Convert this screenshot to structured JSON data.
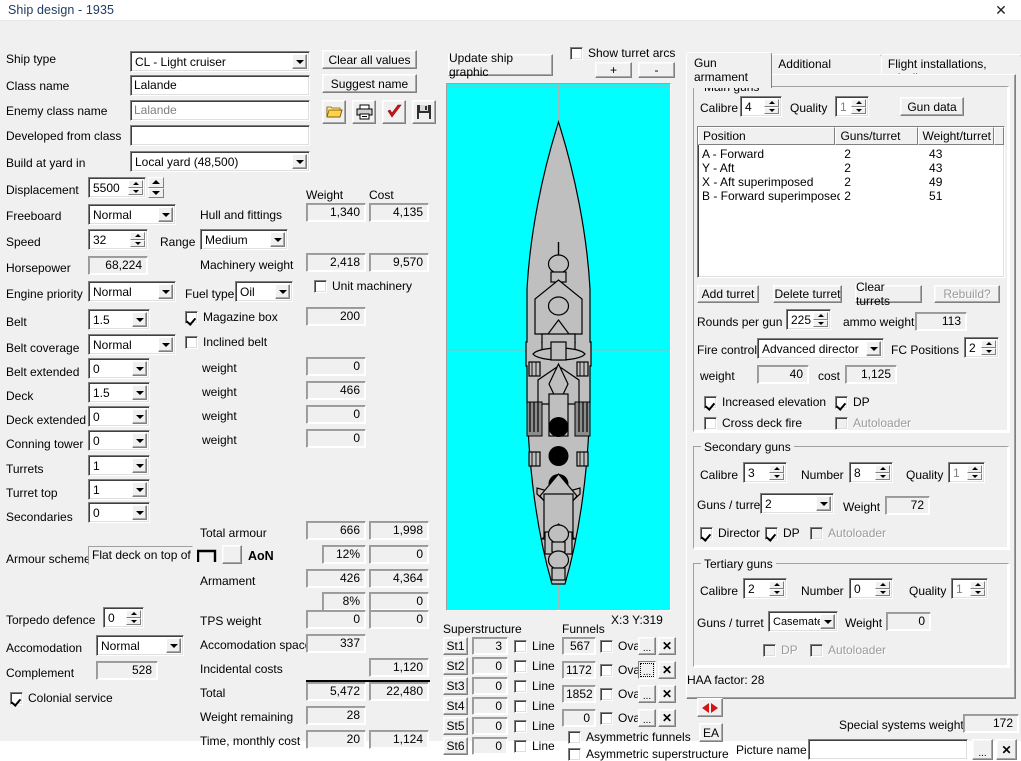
{
  "window": {
    "title": "Ship design - 1935",
    "close_icon": "close-icon"
  },
  "left": {
    "fields": [
      {
        "label": "Ship type",
        "value": "CL - Light cruiser",
        "type": "combo"
      },
      {
        "label": "Class name",
        "value": "Lalande",
        "type": "text"
      },
      {
        "label": "Enemy class name",
        "value": "Lalande",
        "type": "text-disabled"
      },
      {
        "label": "Developed from class",
        "value": "",
        "type": "text"
      },
      {
        "label": "Build at yard in",
        "value": "Local yard (48,500)",
        "type": "combo"
      }
    ],
    "displacement": {
      "label": "Displacement",
      "value": "5500"
    },
    "freeboard": {
      "label": "Freeboard",
      "value": "Normal"
    },
    "speed": {
      "label": "Speed",
      "value": "32"
    },
    "range": {
      "label": "Range",
      "value": "Medium"
    },
    "horsepower": {
      "label": "Horsepower",
      "value": "68,224"
    },
    "engine_priority": {
      "label": "Engine priority",
      "value": "Normal"
    },
    "fuel_type": {
      "label": "Fuel type",
      "value": "Oil"
    },
    "belt": {
      "label": "Belt",
      "value": "1.5"
    },
    "belt_coverage": {
      "label": "Belt coverage",
      "value": "Normal"
    },
    "belt_extended": {
      "label": "Belt extended",
      "value": "0"
    },
    "deck": {
      "label": "Deck",
      "value": "1.5"
    },
    "deck_extended": {
      "label": "Deck extended",
      "value": "0"
    },
    "conning_tower": {
      "label": "Conning tower",
      "value": "0"
    },
    "turrets": {
      "label": "Turrets",
      "value": "1"
    },
    "turret_top": {
      "label": "Turret top",
      "value": "1"
    },
    "secondaries": {
      "label": "Secondaries",
      "value": "0"
    },
    "armour_scheme": {
      "label": "Armour scheme",
      "value": "Flat deck on top of",
      "aon_label": "AoN"
    },
    "torpedo_defence": {
      "label": "Torpedo defence",
      "value": "0"
    },
    "accomodation": {
      "label": "Accomodation",
      "value": "Normal"
    },
    "complement": {
      "label": "Complement",
      "value": "528"
    },
    "colonial_service": {
      "label": "Colonial service",
      "checked": true
    }
  },
  "weights": {
    "col_weight": "Weight",
    "col_cost": "Cost",
    "rows": [
      {
        "label": "Hull and fittings",
        "weight": "1,340",
        "cost": "4,135"
      },
      {
        "label": "Machinery weight",
        "weight": "2,418",
        "cost": "9,570"
      },
      {
        "label": "Magazine box",
        "weight": "200",
        "cost": ""
      },
      {
        "label": "weight",
        "weight": "0",
        "cost": ""
      },
      {
        "label": "weight",
        "weight": "466",
        "cost": ""
      },
      {
        "label": "weight",
        "weight": "0",
        "cost": ""
      },
      {
        "label": "weight",
        "weight": "0",
        "cost": ""
      },
      {
        "label": "Total armour",
        "weight": "666",
        "cost": "1,998"
      },
      {
        "label": "",
        "weight": "12%",
        "cost": "0"
      },
      {
        "label": "Armament",
        "weight": "426",
        "cost": "4,364"
      },
      {
        "label": "",
        "weight": "8%",
        "cost": "0"
      },
      {
        "label": "TPS weight",
        "weight": "0",
        "cost": "0"
      },
      {
        "label": "Accomodation space",
        "weight": "337",
        "cost": ""
      },
      {
        "label": "Incidental costs",
        "weight": "",
        "cost": "1,120"
      },
      {
        "label": "Total",
        "weight": "5,472",
        "cost": "22,480"
      },
      {
        "label": "Weight remaining",
        "weight": "28",
        "cost": ""
      },
      {
        "label": "Time, monthly cost",
        "weight": "20",
        "cost": "1,124"
      }
    ],
    "unit_machinery": {
      "label": "Unit machinery",
      "checked": false
    },
    "magazine_box": {
      "label": "Magazine box",
      "checked": true
    },
    "inclined_belt": {
      "label": "Inclined belt",
      "checked": false
    }
  },
  "toolbar": {
    "clear_all_values": "Clear all values",
    "suggest_name": "Suggest name",
    "icons": [
      "folder-open-icon",
      "printer-icon",
      "checkmark-icon",
      "save-disk-icon"
    ],
    "update_ship_graphic": "Update ship graphic",
    "show_turret_arcs": {
      "label": "Show turret arcs",
      "checked": false
    },
    "zoom_in": "+",
    "zoom_out": "-"
  },
  "ship_graphic": {
    "coords": "X:3 Y:319"
  },
  "superstructure": {
    "title": "Superstructure",
    "line_label": "Line",
    "rows": [
      {
        "btn": "St1",
        "value": "3",
        "line": false
      },
      {
        "btn": "St2",
        "value": "0",
        "line": false
      },
      {
        "btn": "St3",
        "value": "0",
        "line": false
      },
      {
        "btn": "St4",
        "value": "0",
        "line": false
      },
      {
        "btn": "St5",
        "value": "0",
        "line": false
      },
      {
        "btn": "St6",
        "value": "0",
        "line": false
      }
    ]
  },
  "funnels": {
    "title": "Funnels",
    "oval_label": "Oval",
    "browse_label": "...",
    "clear_label": "✕",
    "rows": [
      {
        "value": "567",
        "oval": false
      },
      {
        "value": "1172",
        "oval": false
      },
      {
        "value": "1852",
        "oval": false
      },
      {
        "value": "0",
        "oval": false
      }
    ],
    "asym_funnels": {
      "label": "Asymmetric funnels",
      "checked": false
    },
    "asym_superstructure": {
      "label": "Asymmetric superstructure",
      "checked": false
    }
  },
  "tabs": [
    {
      "label": "Gun armament",
      "active": true
    },
    {
      "label": "Additional armament",
      "active": false
    },
    {
      "label": "Flight installations, missiles",
      "active": false
    }
  ],
  "main_guns": {
    "title": "Main guns",
    "calibre": {
      "label": "Calibre",
      "value": "4"
    },
    "quality": {
      "label": "Quality",
      "value": "1"
    },
    "gun_data_btn": "Gun data",
    "columns": [
      "Position",
      "Guns/turret",
      "Weight/turret"
    ],
    "rows": [
      {
        "position": "A - Forward",
        "guns": "2",
        "weight": "43"
      },
      {
        "position": "Y - Aft",
        "guns": "2",
        "weight": "43"
      },
      {
        "position": "X - Aft superimposed",
        "guns": "2",
        "weight": "49"
      },
      {
        "position": "B - Forward superimposed",
        "guns": "2",
        "weight": "51"
      }
    ],
    "add_turret": "Add turret",
    "delete_turret": "Delete turret",
    "clear_turrets": "Clear turrets",
    "rebuild": "Rebuild?",
    "rounds_per_gun": {
      "label": "Rounds per gun",
      "value": "225"
    },
    "ammo_weight": {
      "label": "ammo weight",
      "value": "113"
    },
    "fire_control": {
      "label": "Fire control",
      "value": "Advanced director"
    },
    "fc_positions": {
      "label": "FC Positions",
      "value": "2"
    },
    "fc_weight": {
      "label": "weight",
      "value": "40"
    },
    "fc_cost": {
      "label": "cost",
      "value": "1,125"
    },
    "increased_elevation": {
      "label": "Increased elevation",
      "checked": true
    },
    "dp": {
      "label": "DP",
      "checked": true
    },
    "cross_deck_fire": {
      "label": "Cross deck fire",
      "checked": false
    },
    "autoloader": {
      "label": "Autoloader",
      "checked": false
    }
  },
  "secondary_guns": {
    "title": "Secondary guns",
    "calibre": {
      "label": "Calibre",
      "value": "3"
    },
    "number": {
      "label": "Number",
      "value": "8"
    },
    "quality": {
      "label": "Quality",
      "value": "1"
    },
    "guns_turret": {
      "label": "Guns / turret",
      "value": "2"
    },
    "weight": {
      "label": "Weight",
      "value": "72"
    },
    "director": {
      "label": "Director",
      "checked": true
    },
    "dp": {
      "label": "DP",
      "checked": true
    },
    "autoloader": {
      "label": "Autoloader",
      "checked": false
    }
  },
  "tertiary_guns": {
    "title": "Tertiary guns",
    "calibre": {
      "label": "Calibre",
      "value": "2"
    },
    "number": {
      "label": "Number",
      "value": "0"
    },
    "quality": {
      "label": "Quality",
      "value": "1"
    },
    "guns_turret": {
      "label": "Guns / turret",
      "value": "Casemate:"
    },
    "weight": {
      "label": "Weight",
      "value": "0"
    },
    "dp": {
      "label": "DP",
      "checked": false
    },
    "autoloader": {
      "label": "Autoloader",
      "checked": false
    }
  },
  "haa_factor": "HAA factor: 28",
  "bottom": {
    "flip_icon": "left-right-arrows-icon",
    "ea_button": "EA",
    "special_systems_weight": {
      "label": "Special systems weight",
      "value": "172"
    },
    "picture_name": {
      "label": "Picture name",
      "value": "",
      "browse": "...",
      "clear": "✕"
    }
  }
}
